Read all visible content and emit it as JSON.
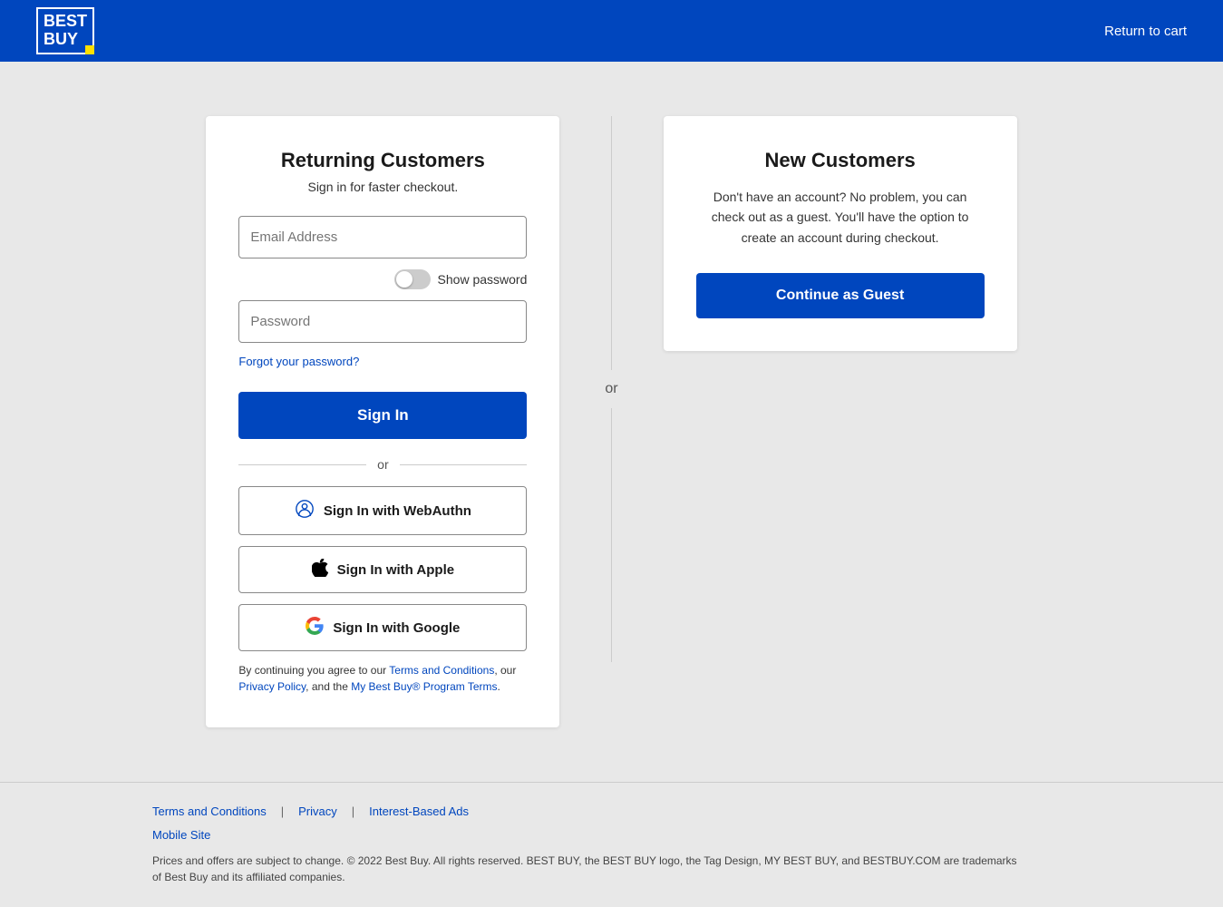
{
  "header": {
    "logo_line1": "BEST",
    "logo_line2": "BUY",
    "return_to_cart": "Return to cart"
  },
  "returning_customers": {
    "title": "Returning Customers",
    "subtitle": "Sign in for faster checkout.",
    "email_placeholder": "Email Address",
    "password_placeholder": "Password",
    "show_password_label": "Show password",
    "forgot_password_label": "Forgot your password?",
    "sign_in_button": "Sign In",
    "or_text": "or",
    "webauthn_button": "Sign In with WebAuthn",
    "apple_button": "Sign In with Apple",
    "google_button": "Sign In with Google",
    "terms_prefix": "By continuing you agree to our ",
    "terms_link": "Terms and Conditions",
    "terms_middle": ", our ",
    "privacy_link": "Privacy Policy",
    "terms_suffix": ", and the ",
    "mybuy_link": "My Best Buy® Program Terms",
    "terms_end": "."
  },
  "separator": {
    "or_text": "or"
  },
  "new_customers": {
    "title": "New Customers",
    "description": "Don't have an account? No problem, you can check out as a guest. You'll have the option to create an account during checkout.",
    "continue_guest_button": "Continue as Guest"
  },
  "footer": {
    "links": [
      {
        "label": "Terms and Conditions",
        "name": "footer-terms-link"
      },
      {
        "label": "Privacy",
        "name": "footer-privacy-link"
      },
      {
        "label": "Interest-Based Ads",
        "name": "footer-ads-link"
      }
    ],
    "mobile_site_link": "Mobile Site",
    "copyright": "Prices and offers are subject to change. © 2022 Best Buy. All rights reserved. BEST BUY, the BEST BUY logo, the Tag Design, MY BEST BUY, and BESTBUY.COM are trademarks of Best Buy and its affiliated companies."
  }
}
